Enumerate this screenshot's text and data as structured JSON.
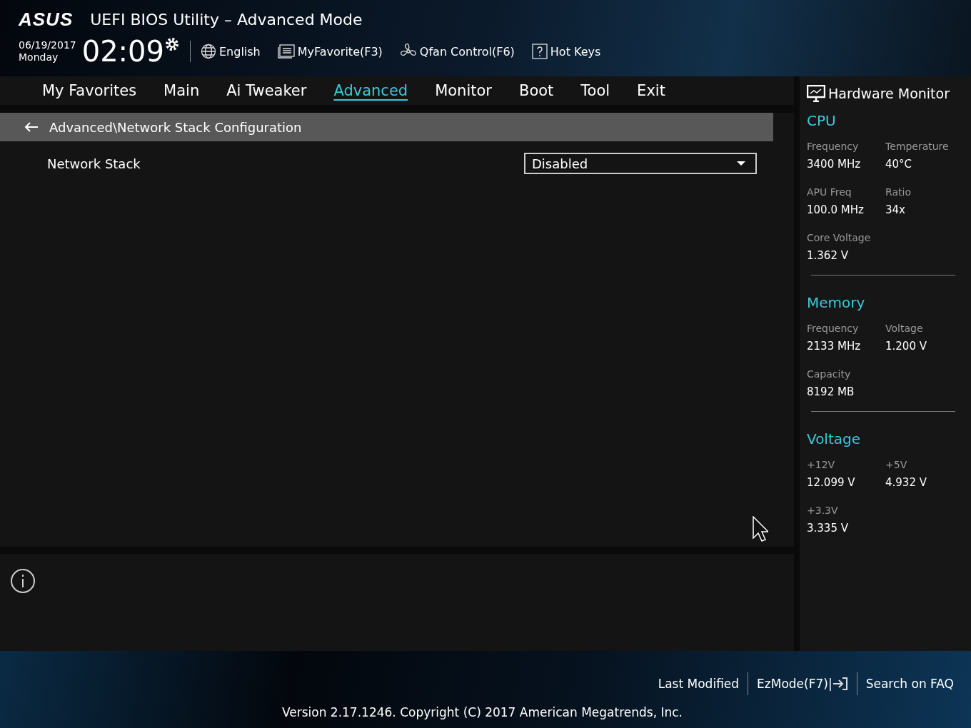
{
  "header": {
    "logo": "ASUS",
    "title": "UEFI BIOS Utility – Advanced Mode",
    "date": "06/19/2017",
    "day": "Monday",
    "time": "02:09",
    "tools": [
      {
        "kind": "globe",
        "label": "English"
      },
      {
        "kind": "list",
        "label": "MyFavorite(F3)"
      },
      {
        "kind": "fan",
        "label": "Qfan Control(F6)"
      },
      {
        "kind": "help",
        "label": "Hot Keys"
      }
    ]
  },
  "tabs": [
    {
      "label": "My Favorites",
      "selected": false
    },
    {
      "label": "Main",
      "selected": false
    },
    {
      "label": "Ai Tweaker",
      "selected": false
    },
    {
      "label": "Advanced",
      "selected": true
    },
    {
      "label": "Monitor",
      "selected": false
    },
    {
      "label": "Boot",
      "selected": false
    },
    {
      "label": "Tool",
      "selected": false
    },
    {
      "label": "Exit",
      "selected": false
    }
  ],
  "breadcrumb": "Advanced\\Network Stack Configuration",
  "settings": [
    {
      "label": "Network Stack",
      "value": "Disabled"
    }
  ],
  "hardware_monitor": {
    "title": "Hardware Monitor",
    "sections": [
      {
        "title": "CPU",
        "items": [
          {
            "label": "Frequency",
            "value": "3400 MHz"
          },
          {
            "label": "Temperature",
            "value": "40°C"
          },
          {
            "label": "APU Freq",
            "value": "100.0 MHz"
          },
          {
            "label": "Ratio",
            "value": "34x"
          },
          {
            "label": "Core Voltage",
            "value": "1.362 V"
          }
        ]
      },
      {
        "title": "Memory",
        "items": [
          {
            "label": "Frequency",
            "value": "2133 MHz"
          },
          {
            "label": "Voltage",
            "value": "1.200 V"
          },
          {
            "label": "Capacity",
            "value": "8192 MB"
          }
        ]
      },
      {
        "title": "Voltage",
        "items": [
          {
            "label": "+12V",
            "value": "12.099 V"
          },
          {
            "label": "+5V",
            "value": "4.932 V"
          },
          {
            "label": "+3.3V",
            "value": "3.335 V"
          }
        ]
      }
    ]
  },
  "footer": {
    "links": [
      {
        "kind": "text",
        "label": "Last Modified"
      },
      {
        "kind": "exit",
        "label": "EzMode(F7)|"
      },
      {
        "kind": "text",
        "label": "Search on FAQ"
      }
    ],
    "version": "Version 2.17.1246. Copyright (C) 2017 American Megatrends, Inc."
  }
}
